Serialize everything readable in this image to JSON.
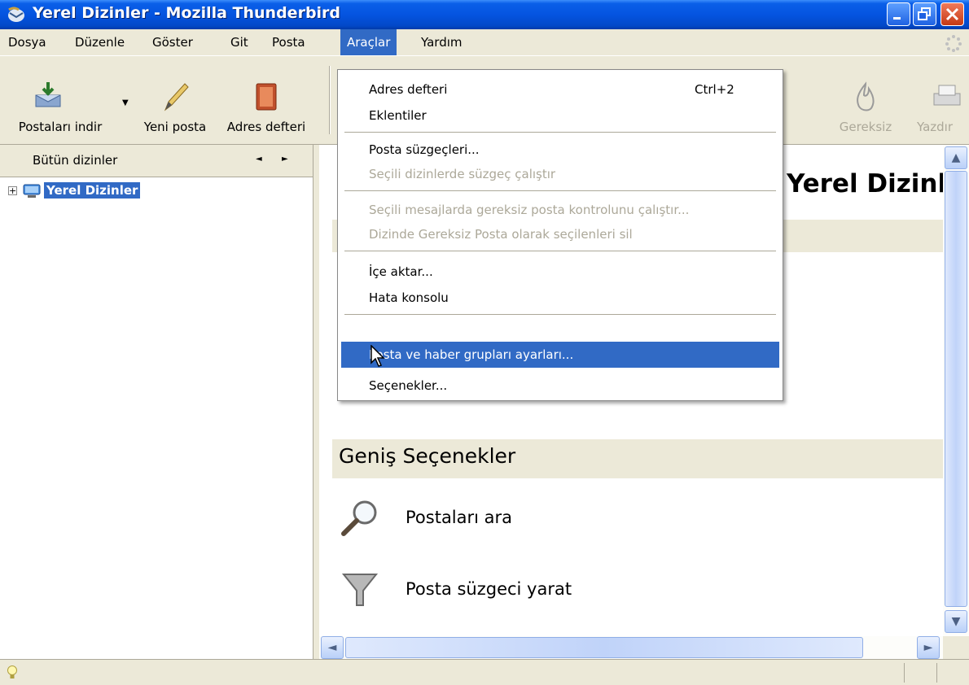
{
  "window": {
    "title": "Yerel Dizinler - Mozilla Thunderbird"
  },
  "menubar": {
    "items": [
      {
        "label": "Dosya"
      },
      {
        "label": "Düzenle"
      },
      {
        "label": "Göster"
      },
      {
        "label": "Git"
      },
      {
        "label": "Posta"
      },
      {
        "label": "Araçlar",
        "active": true
      },
      {
        "label": "Yardım"
      }
    ]
  },
  "toolbar": {
    "get_mail": "Postaları indir",
    "new_mail": "Yeni posta",
    "address_book": "Adres defteri",
    "junk": "Gereksiz",
    "print": "Yazdır"
  },
  "folder_pane": {
    "header": "Bütün dizinler",
    "tree": [
      {
        "label": "Yerel Dizinler",
        "selected": true
      }
    ]
  },
  "content": {
    "page_title": "Yerel Dizinler",
    "section_advanced": "Geniş Seçenekler",
    "actions": [
      {
        "label": "Postaları ara",
        "icon": "magnifier-icon"
      },
      {
        "label": "Posta süzgeci yarat",
        "icon": "funnel-icon"
      }
    ]
  },
  "tools_menu": {
    "items": [
      {
        "label": "Adres defteri",
        "shortcut": "Ctrl+2"
      },
      {
        "label": "Eklentiler"
      },
      {
        "label": "Posta süzgeçleri..."
      },
      {
        "label": "Seçili dizinlerde süzgeç çalıştır",
        "disabled": true
      },
      {
        "label": "Seçili mesajlarda gereksiz posta kontrolunu çalıştır...",
        "disabled": true
      },
      {
        "label": "Dizinde Gereksiz Posta olarak seçilenleri sil",
        "disabled": true
      },
      {
        "label": "İçe aktar..."
      },
      {
        "label": "Hata konsolu"
      },
      {
        "label": "Posta ve haber grupları ayarları...",
        "highlighted": true
      },
      {
        "label": "Seçenekler..."
      }
    ]
  },
  "colors": {
    "selection": "#316ac5",
    "titlebar": "#0554e0",
    "chrome": "#ece9d8"
  }
}
